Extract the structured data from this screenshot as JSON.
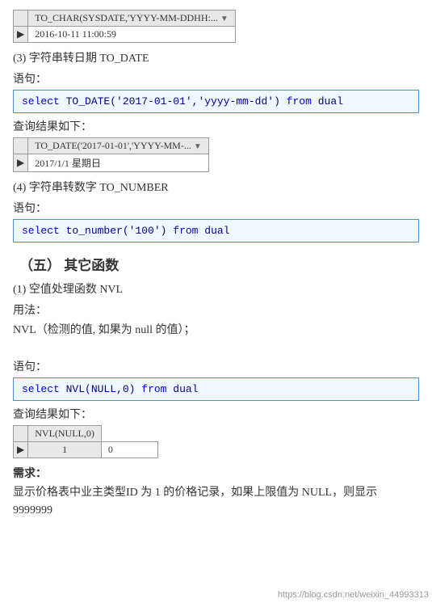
{
  "page": {
    "top_table": {
      "header": "TO_CHAR(SYSDATE,'YYYY-MM-DDHH:...",
      "row_value": "2016-10-11 11:00:59",
      "dropdown_symbol": "▼"
    },
    "section3": {
      "title": "(3)  字符串转日期 TO_DATE",
      "syntax_label": "语句：",
      "code": "select TO_DATE('2017-01-01','yyyy-mm-dd') from dual",
      "code_parts": {
        "select": "select",
        "func_call": "TO_DATE('2017-01-01','yyyy-mm-dd')",
        "from": "from",
        "table": "dual"
      },
      "result_label": "查询结果如下：",
      "result_header": "TO_DATE('2017-01-01','YYYY-MM-...",
      "result_value": "2017/1/1 星期日",
      "dropdown_symbol": "▼"
    },
    "section4": {
      "title": "(4)  字符串转数字 TO_NUMBER",
      "syntax_label": "语句：",
      "code": "select to_number('100') from dual",
      "code_parts": {
        "select": "select",
        "func_call": "to_number('100')",
        "from": "from",
        "table": "dual"
      }
    },
    "section5": {
      "big_title": "（五）  其它函数",
      "sub1": {
        "title": "(1)  空值处理函数 NVL",
        "usage_label": "用法：",
        "usage_text": "NVL（检测的值, 如果为 null 的值）；",
        "syntax_label": "语句：",
        "code": "select NVL(NULL,0) from dual",
        "code_parts": {
          "select": "select",
          "func_call": "NVL(NULL,0)",
          "from": "from",
          "table": "dual"
        },
        "result_label": "查询结果如下：",
        "result_header": "NVL(NULL,0)",
        "result_value": "0",
        "row_num": "1",
        "requirement_label": "需求：",
        "requirement_text": "显示价格表中业主类型ID 为 1 的价格记录，如果上限值为 NULL，则显示 9999999"
      }
    },
    "watermark": "https://blog.csdn.net/weixin_44993313"
  }
}
